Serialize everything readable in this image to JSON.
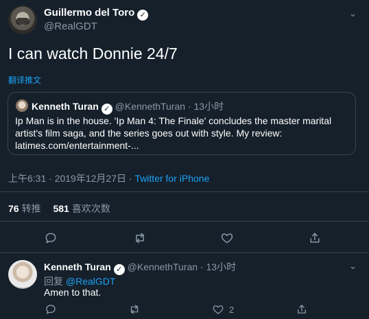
{
  "main_tweet": {
    "author_name": "Guillermo del Toro",
    "author_handle": "@RealGDT",
    "text": "I can watch Donnie 24/7",
    "translate_label": "翻译推文",
    "timestamp": "上午6:31 · 2019年12月27日 · ",
    "source": "Twitter for iPhone",
    "retweets_count": "76",
    "retweets_label": "转推",
    "likes_count": "581",
    "likes_label": "喜欢次数"
  },
  "quoted_tweet": {
    "author_name": "Kenneth Turan",
    "author_handle": "@KennethTuran",
    "time": "· 13小时",
    "body": "Ip Man is in  the house. 'Ip Man 4: The Finale' concludes the master marital artist's film saga, and the series goes out with style. My review: latimes.com/entertainment-..."
  },
  "reply": {
    "author_name": "Kenneth Turan",
    "author_handle": "@KennethTuran",
    "time": "· 13小时",
    "replying_label": "回复",
    "replying_to": "@RealGDT",
    "text": "Amen to that.",
    "like_count": "2"
  },
  "icons": {
    "verified": "verified-badge-icon",
    "more": "chevron-down-icon",
    "reply": "reply-icon",
    "retweet": "retweet-icon",
    "like": "heart-icon",
    "share": "share-icon"
  },
  "colors": {
    "background": "#15202b",
    "muted": "#8899a6",
    "link": "#1da1f2",
    "border": "#38444d"
  }
}
